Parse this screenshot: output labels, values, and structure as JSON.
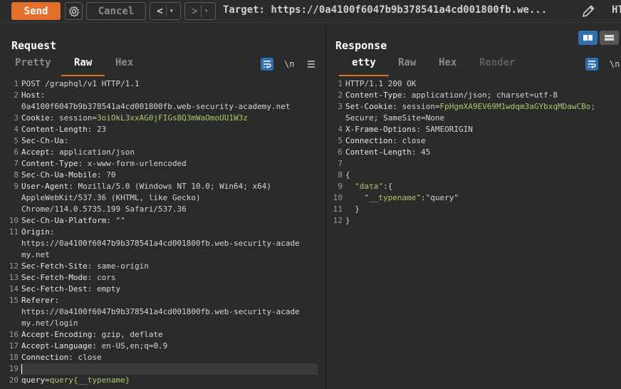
{
  "toolbar": {
    "send_label": "Send",
    "cancel_label": "Cancel",
    "back_label": "<",
    "forward_label": ">",
    "dropdown_glyph": "▾",
    "target_text": "Target: https://0a4100f6047b9b378541a4cd001800fb.we...",
    "http_version_label": "HT"
  },
  "request": {
    "title": "Request",
    "tabs": [
      "Pretty",
      "Raw",
      "Hex"
    ],
    "active_tab": "Raw",
    "newline_label": "\\n",
    "line_numbers": [
      "1",
      "2",
      "",
      "3",
      "4",
      "5",
      "6",
      "7",
      "8",
      "9",
      "",
      "",
      "10",
      "11",
      "",
      "",
      "12",
      "13",
      "14",
      "15",
      "",
      "",
      "16",
      "17",
      "18",
      "19",
      "20"
    ],
    "lines": [
      {
        "t": "plain",
        "text": "POST /graphql/v1 HTTP/1.1"
      },
      {
        "t": "header",
        "key": "Host",
        "value": ""
      },
      {
        "t": "plain",
        "text": "0a4100f6047b9b378541a4cd001800fb.web-security-academy.net"
      },
      {
        "t": "cookie",
        "key": "Cookie",
        "name": "session",
        "value": "3oiOkL3xxAG0jFIGsBQ3mWaOmoUU1W3z"
      },
      {
        "t": "header",
        "key": "Content-Length",
        "value": " 23"
      },
      {
        "t": "header",
        "key": "Sec-Ch-Ua",
        "value": ""
      },
      {
        "t": "header",
        "key": "Accept",
        "value": " application/json"
      },
      {
        "t": "header",
        "key": "Content-Type",
        "value": " x-www-form-urlencoded"
      },
      {
        "t": "header",
        "key": "Sec-Ch-Ua-Mobile",
        "value": " ?0"
      },
      {
        "t": "header",
        "key": "User-Agent",
        "value": " Mozilla/5.0 (Windows NT 10.0; Win64; x64)"
      },
      {
        "t": "plain",
        "text": "AppleWebKit/537.36 (KHTML, like Gecko)"
      },
      {
        "t": "plain",
        "text": "Chrome/114.0.5735.199 Safari/537.36"
      },
      {
        "t": "header",
        "key": "Sec-Ch-Ua-Platform",
        "value": " \"\""
      },
      {
        "t": "header",
        "key": "Origin",
        "value": ""
      },
      {
        "t": "plain",
        "text": "https://0a4100f6047b9b378541a4cd001800fb.web-security-acade"
      },
      {
        "t": "plain",
        "text": "my.net"
      },
      {
        "t": "header",
        "key": "Sec-Fetch-Site",
        "value": " same-origin"
      },
      {
        "t": "header",
        "key": "Sec-Fetch-Mode",
        "value": " cors"
      },
      {
        "t": "header",
        "key": "Sec-Fetch-Dest",
        "value": " empty"
      },
      {
        "t": "header",
        "key": "Referer",
        "value": ""
      },
      {
        "t": "plain",
        "text": "https://0a4100f6047b9b378541a4cd001800fb.web-security-acade"
      },
      {
        "t": "plain",
        "text": "my.net/login"
      },
      {
        "t": "header",
        "key": "Accept-Encoding",
        "value": " gzip, deflate"
      },
      {
        "t": "header",
        "key": "Accept-Language",
        "value": " en-US,en;q=0.9"
      },
      {
        "t": "header",
        "key": "Connection",
        "value": " close"
      },
      {
        "t": "empty"
      },
      {
        "t": "body",
        "key": "query",
        "value": "query{__typename}"
      }
    ]
  },
  "response": {
    "title": "Response",
    "tabs": [
      "etty",
      "Raw",
      "Hex",
      "Render"
    ],
    "active_tab": "etty",
    "disabled_tab": "Render",
    "newline_label": "\\n",
    "line_numbers": [
      "1",
      "2",
      "3",
      "",
      "4",
      "5",
      "6",
      "7",
      "8",
      "9",
      "10",
      "11",
      "12"
    ],
    "lines": [
      {
        "t": "plain",
        "text": "HTTP/1.1 200 OK"
      },
      {
        "t": "header",
        "key": "Content-Type",
        "value": " application/json; charset=utf-8"
      },
      {
        "t": "cookie",
        "key": "Set-Cookie",
        "name": "session",
        "value": "FpHgmXA9EV69M1wdqm3aGYbxqMDawCBo;"
      },
      {
        "t": "plain",
        "text": "Secure; SameSite=None"
      },
      {
        "t": "header",
        "key": "X-Frame-Options",
        "value": " SAMEORIGIN"
      },
      {
        "t": "header",
        "key": "Connection",
        "value": " close"
      },
      {
        "t": "header",
        "key": "Content-Length",
        "value": " 45"
      },
      {
        "t": "empty"
      },
      {
        "t": "plain",
        "text": "{"
      },
      {
        "t": "json",
        "indent": "  ",
        "key": "\"data\"",
        "rest": ":{"
      },
      {
        "t": "json",
        "indent": "    ",
        "key": "\"__typename\"",
        "rest": ":\"query\""
      },
      {
        "t": "plain",
        "text": "  }"
      },
      {
        "t": "plain",
        "text": "}"
      }
    ]
  },
  "colors": {
    "accent": "#e36f2c",
    "cookie_value": "#a8c96a",
    "icon_blue": "#2f6fb0"
  }
}
